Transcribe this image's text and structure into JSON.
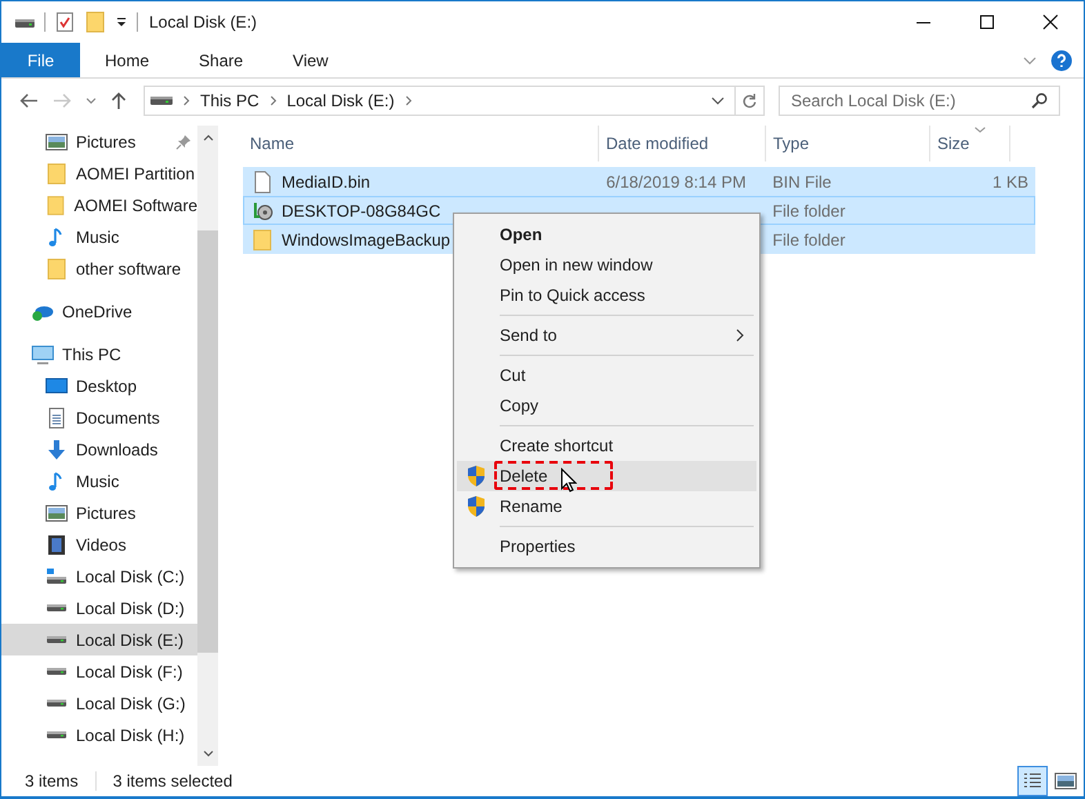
{
  "window": {
    "title": "Local Disk (E:)"
  },
  "ribbon_tabs": [
    {
      "label": "File",
      "selected": true
    },
    {
      "label": "Home",
      "selected": false
    },
    {
      "label": "Share",
      "selected": false
    },
    {
      "label": "View",
      "selected": false
    }
  ],
  "address": {
    "path": [
      "This PC",
      "Local Disk (E:)"
    ],
    "search": {
      "placeholder": "Search Local Disk (E:)"
    }
  },
  "sidebar": {
    "quick_access": [
      {
        "label": "Pictures",
        "kind": "pictures",
        "pinned": true,
        "selected": false
      },
      {
        "label": "AOMEI Partition",
        "kind": "folder",
        "pinned": false,
        "selected": false
      },
      {
        "label": "AOMEI Software",
        "kind": "folder",
        "pinned": false,
        "selected": false
      },
      {
        "label": "Music",
        "kind": "music",
        "pinned": false,
        "selected": false
      },
      {
        "label": "other software",
        "kind": "folder",
        "pinned": false,
        "selected": false
      }
    ],
    "locations": [
      {
        "label": "OneDrive",
        "kind": "onedrive",
        "selected": false
      },
      {
        "label": "This PC",
        "kind": "pc",
        "selected": false,
        "children": [
          {
            "label": "Desktop",
            "kind": "desktop",
            "selected": false
          },
          {
            "label": "Documents",
            "kind": "documents",
            "selected": false
          },
          {
            "label": "Downloads",
            "kind": "downloads",
            "selected": false
          },
          {
            "label": "Music",
            "kind": "music",
            "selected": false
          },
          {
            "label": "Pictures",
            "kind": "pictures",
            "selected": false
          },
          {
            "label": "Videos",
            "kind": "videos",
            "selected": false
          },
          {
            "label": "Local Disk (C:)",
            "kind": "system-disk",
            "selected": false
          },
          {
            "label": "Local Disk (D:)",
            "kind": "disk",
            "selected": false
          },
          {
            "label": "Local Disk (E:)",
            "kind": "disk",
            "selected": true
          },
          {
            "label": "Local Disk (F:)",
            "kind": "disk",
            "selected": false
          },
          {
            "label": "Local Disk (G:)",
            "kind": "disk",
            "selected": false
          },
          {
            "label": "Local Disk (H:)",
            "kind": "disk",
            "selected": false
          }
        ]
      }
    ]
  },
  "file_list": {
    "columns": [
      {
        "label": "Name",
        "sorted": false
      },
      {
        "label": "Date modified",
        "sorted": false
      },
      {
        "label": "Type",
        "sorted": false
      },
      {
        "label": "Size",
        "sorted": true
      }
    ],
    "rows": [
      {
        "name": "MediaID.bin",
        "kind": "file",
        "date": "6/18/2019 8:14 PM",
        "type": "BIN File",
        "size": "1 KB",
        "selected": true,
        "focused": false
      },
      {
        "name": "DESKTOP-08G84GC",
        "kind": "backup",
        "type": "File folder",
        "selected": true,
        "focused": true
      },
      {
        "name": "WindowsImageBackup",
        "kind": "folder",
        "type": "File folder",
        "selected": true,
        "focused": false
      }
    ]
  },
  "context_menu": {
    "items": [
      {
        "kind": "item",
        "label": "Open",
        "default": true,
        "highlighted": false
      },
      {
        "kind": "item",
        "label": "Open in new window",
        "highlighted": false
      },
      {
        "kind": "item",
        "label": "Pin to Quick access",
        "highlighted": false
      },
      {
        "kind": "separator"
      },
      {
        "kind": "item",
        "label": "Send to",
        "submenu": true,
        "highlighted": false
      },
      {
        "kind": "separator"
      },
      {
        "kind": "item",
        "label": "Cut",
        "highlighted": false
      },
      {
        "kind": "item",
        "label": "Copy",
        "highlighted": false
      },
      {
        "kind": "separator"
      },
      {
        "kind": "item",
        "label": "Create shortcut",
        "highlighted": false
      },
      {
        "kind": "admin-item",
        "label": "Delete",
        "highlighted": true,
        "marked": true
      },
      {
        "kind": "admin-item",
        "label": "Rename",
        "highlighted": false
      },
      {
        "kind": "separator"
      },
      {
        "kind": "item",
        "label": "Properties",
        "highlighted": false
      }
    ]
  },
  "status_bar": {
    "count": "3 items",
    "selection": "3 items selected",
    "views": [
      {
        "kind": "details",
        "selected": true
      },
      {
        "kind": "large-icons",
        "selected": false
      }
    ]
  }
}
